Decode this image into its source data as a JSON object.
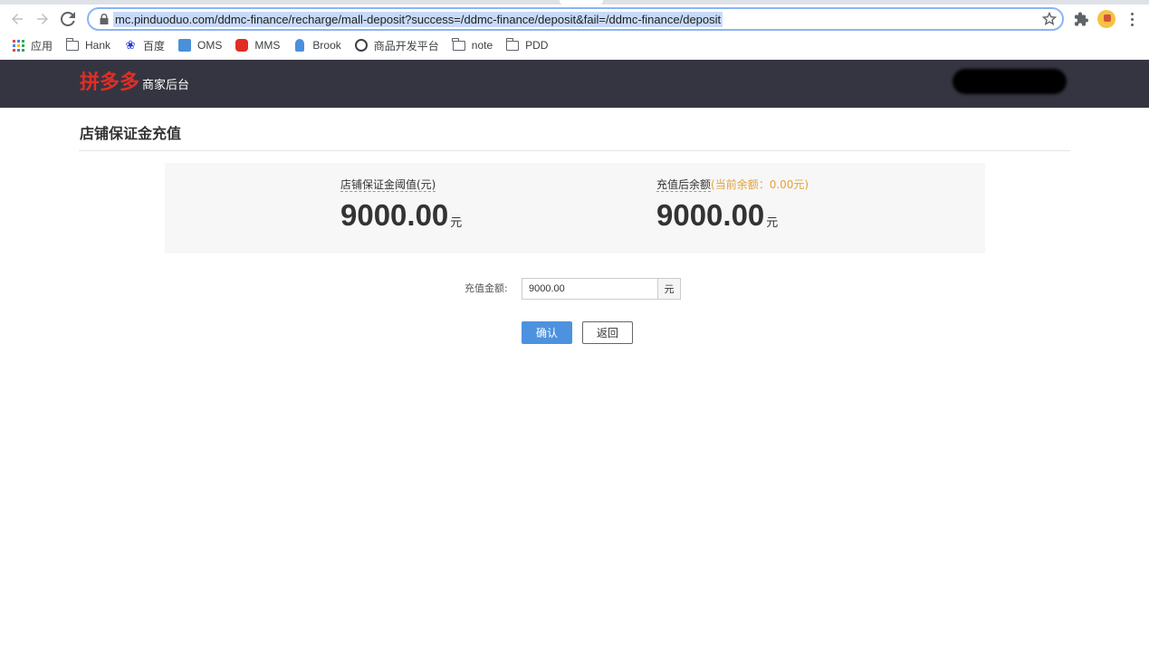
{
  "browser": {
    "url": "mc.pinduoduo.com/ddmc-finance/recharge/mall-deposit?success=/ddmc-finance/deposit&fail=/ddmc-finance/deposit",
    "bookmarks": [
      {
        "label": "应用",
        "icon": "apps-grid-icon"
      },
      {
        "label": "Hank",
        "icon": "folder-icon"
      },
      {
        "label": "百度",
        "icon": "baidu-paw-icon"
      },
      {
        "label": "OMS",
        "icon": "oms-icon"
      },
      {
        "label": "MMS",
        "icon": "mms-icon"
      },
      {
        "label": "Brook",
        "icon": "brook-icon"
      },
      {
        "label": "商品开发平台",
        "icon": "globe-icon"
      },
      {
        "label": "note",
        "icon": "folder-icon"
      },
      {
        "label": "PDD",
        "icon": "folder-icon"
      }
    ]
  },
  "header": {
    "logo_text": "拼多多",
    "subtitle": "商家后台",
    "brand_color": "#e02e24",
    "background_color": "#353541"
  },
  "main": {
    "title": "店铺保证金充值",
    "summary": {
      "threshold": {
        "label": "店铺保证金阈值(元)",
        "value": "9000.00",
        "unit": "元"
      },
      "balance_after": {
        "label": "充值后余额",
        "note": "(当前余额：0.00元)",
        "value": "9000.00",
        "unit": "元"
      }
    },
    "form": {
      "amount_label": "充值金额:",
      "amount_value": "9000.00",
      "amount_unit": "元",
      "confirm_label": "确认",
      "back_label": "返回"
    }
  }
}
